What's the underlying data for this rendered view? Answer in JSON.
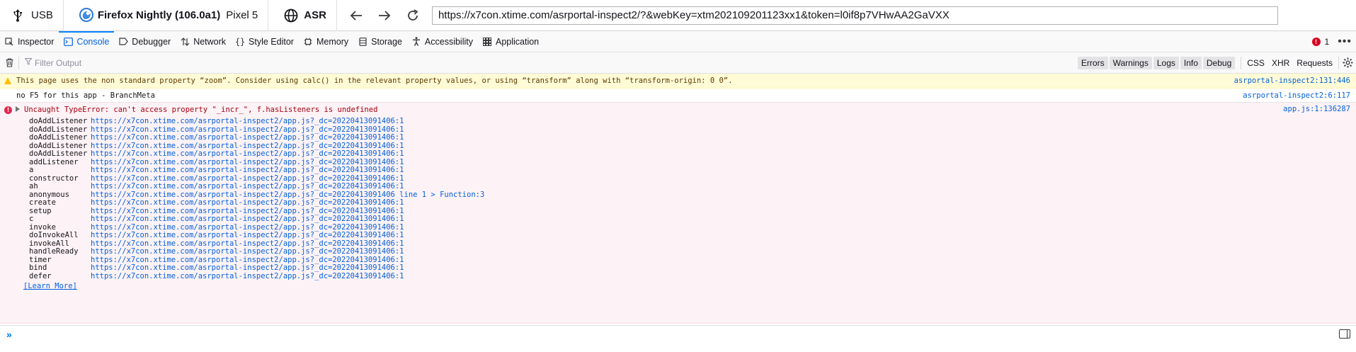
{
  "topbar": {
    "device_icon": "usb-icon",
    "connection": "USB",
    "browser_icon": "firefox-nightly-icon",
    "browser": "Firefox Nightly (106.0a1)",
    "device": "Pixel 5",
    "target_icon": "globe-icon",
    "target": "ASR",
    "url": "https://x7con.xtime.com/asrportal-inspect2/?&webKey=xtm202109201123xx1&token=l0if8p7VHwAA2GaVXX"
  },
  "tabs": [
    {
      "label": "Inspector",
      "icon": "inspector-icon"
    },
    {
      "label": "Console",
      "icon": "console-icon",
      "active": true
    },
    {
      "label": "Debugger",
      "icon": "debugger-icon"
    },
    {
      "label": "Network",
      "icon": "network-icon"
    },
    {
      "label": "Style Editor",
      "icon": "style-editor-icon"
    },
    {
      "label": "Memory",
      "icon": "memory-icon"
    },
    {
      "label": "Storage",
      "icon": "storage-icon"
    },
    {
      "label": "Accessibility",
      "icon": "accessibility-icon"
    },
    {
      "label": "Application",
      "icon": "application-icon"
    }
  ],
  "error_count": "1",
  "console_toolbar": {
    "filter_placeholder": "Filter Output",
    "levels": [
      "Errors",
      "Warnings",
      "Logs",
      "Info",
      "Debug"
    ],
    "categories": [
      "CSS",
      "XHR",
      "Requests"
    ]
  },
  "messages": {
    "warning": {
      "text": "This page uses the non standard property “zoom”. Consider using calc() in the relevant property values, or using “transform” along with “transform-origin: 0 0”.",
      "source": "asrportal-inspect2:131:446"
    },
    "log": {
      "text": "no F5 for this app - BranchMeta",
      "source": "asrportal-inspect2:6:117"
    },
    "error": {
      "text": "Uncaught TypeError: can't access property \"_incr_\", f.hasListeners is undefined",
      "source": "app.js:1:136287",
      "learn_more": "[Learn More]",
      "frames": [
        {
          "fn": "doAddListener",
          "loc": "https://x7con.xtime.com/asrportal-inspect2/app.js?_dc=20220413091406:1"
        },
        {
          "fn": "doAddListener",
          "loc": "https://x7con.xtime.com/asrportal-inspect2/app.js?_dc=20220413091406:1"
        },
        {
          "fn": "doAddListener",
          "loc": "https://x7con.xtime.com/asrportal-inspect2/app.js?_dc=20220413091406:1"
        },
        {
          "fn": "doAddListener",
          "loc": "https://x7con.xtime.com/asrportal-inspect2/app.js?_dc=20220413091406:1"
        },
        {
          "fn": "doAddListener",
          "loc": "https://x7con.xtime.com/asrportal-inspect2/app.js?_dc=20220413091406:1"
        },
        {
          "fn": "addListener",
          "loc": "https://x7con.xtime.com/asrportal-inspect2/app.js?_dc=20220413091406:1"
        },
        {
          "fn": "a",
          "loc": "https://x7con.xtime.com/asrportal-inspect2/app.js?_dc=20220413091406:1"
        },
        {
          "fn": "constructor",
          "loc": "https://x7con.xtime.com/asrportal-inspect2/app.js?_dc=20220413091406:1"
        },
        {
          "fn": "ah",
          "loc": "https://x7con.xtime.com/asrportal-inspect2/app.js?_dc=20220413091406:1"
        },
        {
          "fn": "anonymous",
          "loc": "https://x7con.xtime.com/asrportal-inspect2/app.js?_dc=20220413091406 line 1 > Function:3"
        },
        {
          "fn": "create",
          "loc": "https://x7con.xtime.com/asrportal-inspect2/app.js?_dc=20220413091406:1"
        },
        {
          "fn": "setup",
          "loc": "https://x7con.xtime.com/asrportal-inspect2/app.js?_dc=20220413091406:1"
        },
        {
          "fn": "c",
          "loc": "https://x7con.xtime.com/asrportal-inspect2/app.js?_dc=20220413091406:1"
        },
        {
          "fn": "invoke",
          "loc": "https://x7con.xtime.com/asrportal-inspect2/app.js?_dc=20220413091406:1"
        },
        {
          "fn": "doInvokeAll",
          "loc": "https://x7con.xtime.com/asrportal-inspect2/app.js?_dc=20220413091406:1"
        },
        {
          "fn": "invokeAll",
          "loc": "https://x7con.xtime.com/asrportal-inspect2/app.js?_dc=20220413091406:1"
        },
        {
          "fn": "handleReady",
          "loc": "https://x7con.xtime.com/asrportal-inspect2/app.js?_dc=20220413091406:1"
        },
        {
          "fn": "timer",
          "loc": "https://x7con.xtime.com/asrportal-inspect2/app.js?_dc=20220413091406:1"
        },
        {
          "fn": "bind",
          "loc": "https://x7con.xtime.com/asrportal-inspect2/app.js?_dc=20220413091406:1"
        },
        {
          "fn": "defer",
          "loc": "https://x7con.xtime.com/asrportal-inspect2/app.js?_dc=20220413091406:1"
        }
      ]
    }
  },
  "jsterm": {
    "prompt": "»",
    "value": ""
  }
}
